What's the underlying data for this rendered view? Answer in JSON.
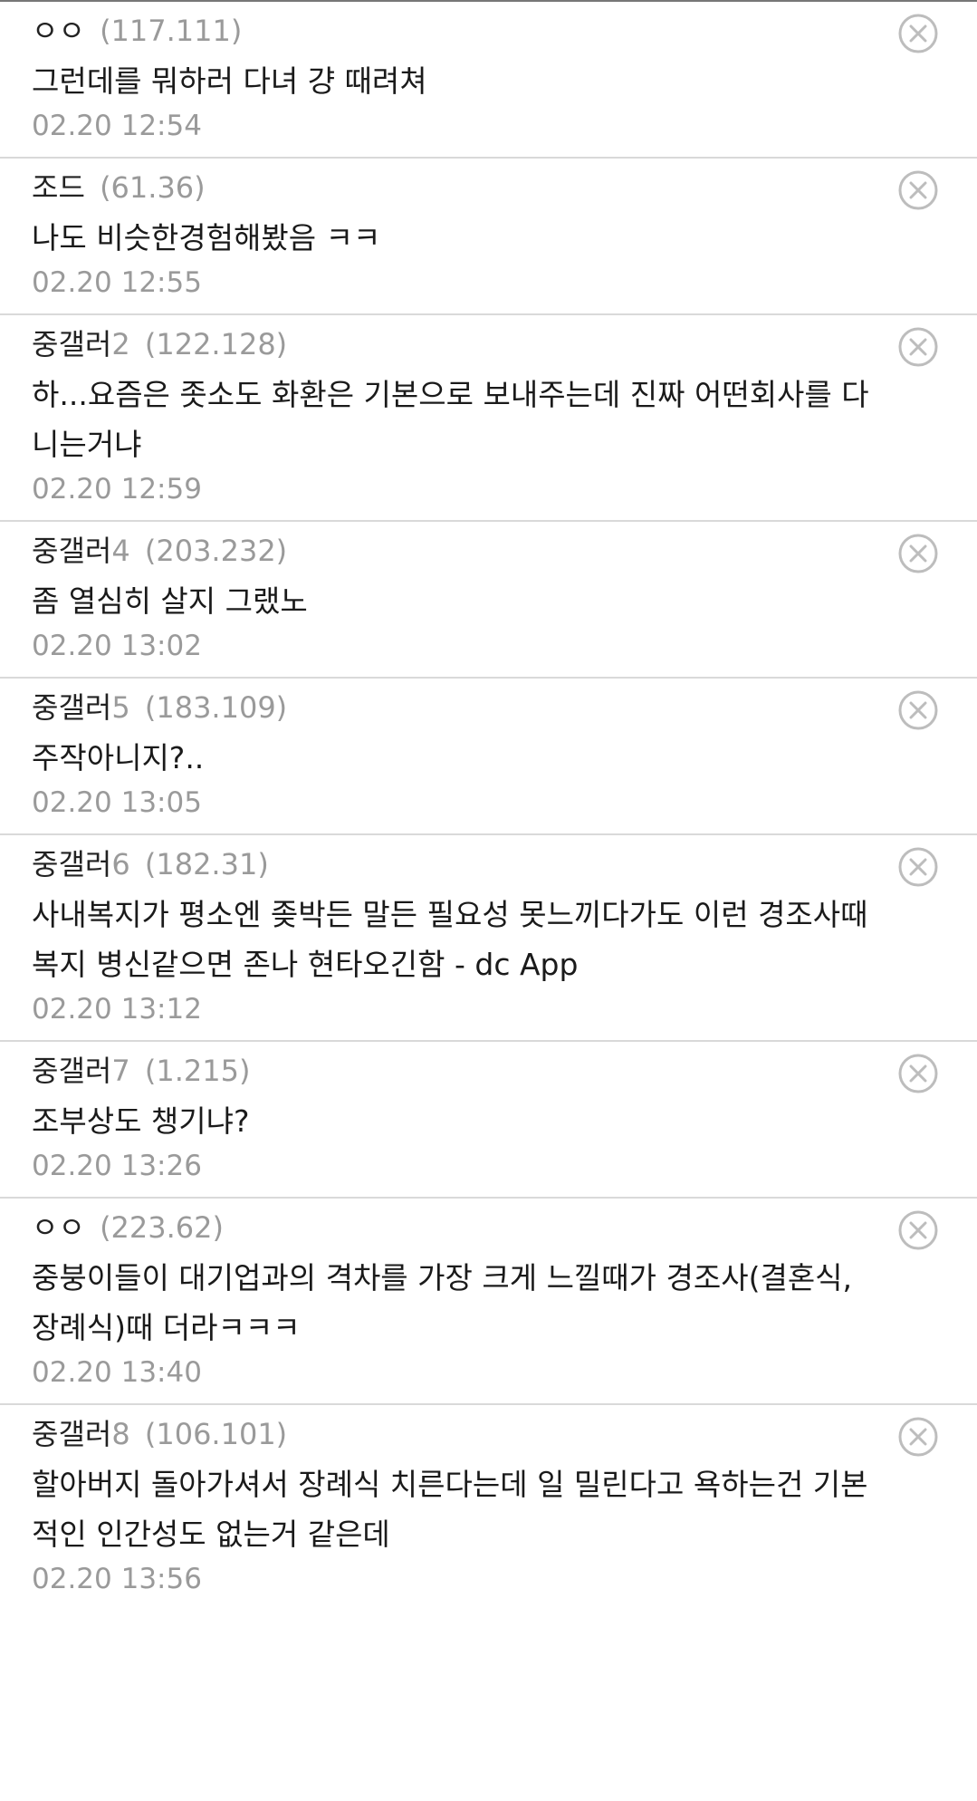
{
  "comments": [
    {
      "nick": "ㅇㅇ",
      "suffix": "",
      "ip": "(117.111)",
      "text": "그런데를 뭐하러 다녀 걍 때려쳐",
      "time": "02.20 12:54"
    },
    {
      "nick": "조드",
      "suffix": "",
      "ip": "(61.36)",
      "text": "나도 비슷한경험해봤음 ㅋㅋ",
      "time": "02.20 12:55"
    },
    {
      "nick": "중갤러",
      "suffix": "2",
      "ip": "(122.128)",
      "text": "하...요즘은 좃소도 화환은 기본으로 보내주는데 진짜 어떤회사를 다니는거냐",
      "time": "02.20 12:59"
    },
    {
      "nick": "중갤러",
      "suffix": "4",
      "ip": "(203.232)",
      "text": "좀 열심히 살지 그랬노",
      "time": "02.20 13:02"
    },
    {
      "nick": "중갤러",
      "suffix": "5",
      "ip": "(183.109)",
      "text": "주작아니지?..",
      "time": "02.20 13:05"
    },
    {
      "nick": "중갤러",
      "suffix": "6",
      "ip": "(182.31)",
      "text": "사내복지가 평소엔 좆박든 말든 필요성 못느끼다가도 이런 경조사때 복지 병신같으면 존나 현타오긴함 - dc App",
      "time": "02.20 13:12"
    },
    {
      "nick": "중갤러",
      "suffix": "7",
      "ip": "(1.215)",
      "text": "조부상도 챙기냐?",
      "time": "02.20 13:26"
    },
    {
      "nick": "ㅇㅇ",
      "suffix": "",
      "ip": "(223.62)",
      "text": "중붕이들이 대기업과의 격차를 가장 크게 느낄때가 경조사(결혼식, 장례식)때 더라ㅋㅋㅋ",
      "time": "02.20 13:40"
    },
    {
      "nick": "중갤러",
      "suffix": "8",
      "ip": "(106.101)",
      "text": "할아버지 돌아가셔서 장례식 치른다는데 일 밀린다고 욕하는건 기본적인 인간성도 없는거 같은데",
      "time": "02.20 13:56"
    }
  ],
  "icons": {
    "delete": "close-circle-icon"
  },
  "colors": {
    "meta": "#9a9a9a",
    "divider": "#d9d9d9",
    "text": "#1a1a1a"
  }
}
